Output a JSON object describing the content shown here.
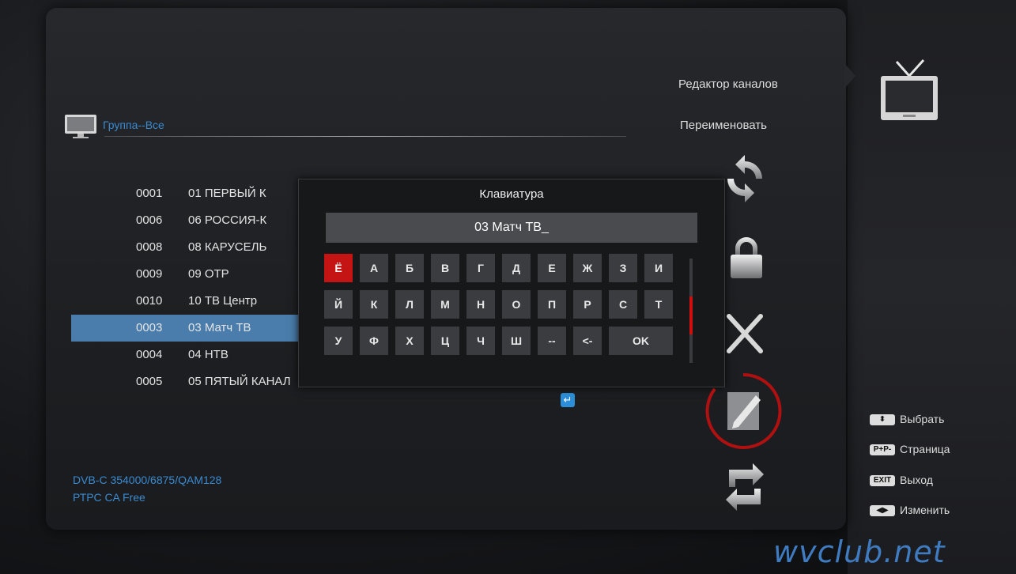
{
  "header": {
    "group_label": "Группа--Все",
    "editor_title": "Редактор каналов",
    "mode_title": "Переименовать"
  },
  "channels": [
    {
      "num": "0001",
      "name": "01 ПЕРВЫЙ К"
    },
    {
      "num": "0006",
      "name": "06 РОССИЯ-К"
    },
    {
      "num": "0008",
      "name": "08 КАРУСЕЛЬ"
    },
    {
      "num": "0009",
      "name": "09 ОТР"
    },
    {
      "num": "0010",
      "name": "10 ТВ Центр"
    },
    {
      "num": "0003",
      "name": "03 Матч ТВ",
      "selected": true
    },
    {
      "num": "0004",
      "name": "04 НТВ"
    },
    {
      "num": "0005",
      "name": "05 ПЯТЫЙ КАНАЛ"
    }
  ],
  "signal": {
    "line1": "DVB-C  354000/6875/QAM128",
    "line2": "РТРС  CA Free"
  },
  "keyboard": {
    "title": "Клавиатура",
    "input_value": "03 Матч ТВ_",
    "rows": [
      [
        "Ё",
        "А",
        "Б",
        "В",
        "Г",
        "Д",
        "Е",
        "Ж",
        "З",
        "И"
      ],
      [
        "Й",
        "К",
        "Л",
        "М",
        "Н",
        "О",
        "П",
        "Р",
        "С",
        "Т"
      ],
      [
        "У",
        "Ф",
        "Х",
        "Ц",
        "Ч",
        "Ш",
        "--",
        "<-",
        "OK"
      ]
    ],
    "active_key": "Ё"
  },
  "side_icons": [
    "move-icon",
    "lock-icon",
    "delete-icon",
    "rename-icon",
    "restore-icon"
  ],
  "hints": [
    {
      "key": "⬍",
      "label": "Выбрать"
    },
    {
      "key": "P+P-",
      "label": "Страница"
    },
    {
      "key": "EXIT",
      "label": "Выход"
    },
    {
      "key": "◀▶",
      "label": "Изменить"
    }
  ],
  "watermark": "wvclub.net",
  "colors": {
    "accent_blue": "#3a8ad0",
    "selected_row": "#4a7dab",
    "active_key": "#c41414"
  }
}
